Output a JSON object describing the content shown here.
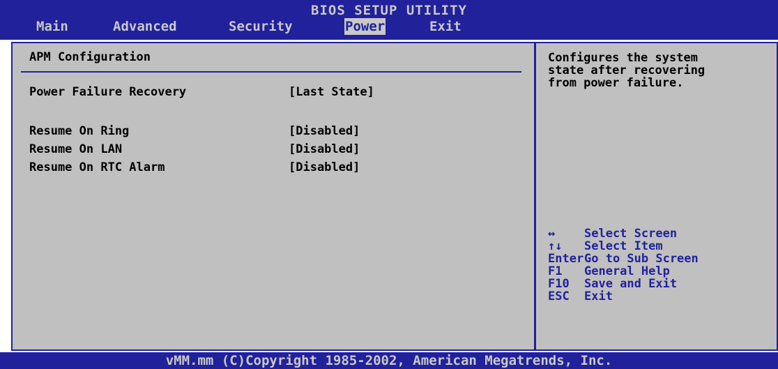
{
  "header": {
    "title": "BIOS SETUP UTILITY",
    "menu": [
      {
        "label": "Main"
      },
      {
        "label": "Advanced"
      },
      {
        "label": "Security"
      },
      {
        "label": "Power"
      },
      {
        "label": "Exit"
      }
    ]
  },
  "section": {
    "title": "APM Configuration",
    "settings": [
      {
        "label": "Power Failure Recovery",
        "value": "[Last State]"
      },
      {
        "label": "Resume On Ring",
        "value": "[Disabled]"
      },
      {
        "label": "Resume On LAN",
        "value": "[Disabled]"
      },
      {
        "label": "Resume On RTC Alarm",
        "value": "[Disabled]"
      }
    ]
  },
  "help": {
    "text": "Configures the system\nstate after recovering\nfrom power failure.",
    "keys": [
      {
        "key": "↔",
        "desc": "Select Screen"
      },
      {
        "key": "↑↓",
        "desc": "Select Item"
      },
      {
        "key": "Enter",
        "desc": "Go to Sub Screen"
      },
      {
        "key": "F1",
        "desc": "General Help"
      },
      {
        "key": "F10",
        "desc": "Save and Exit"
      },
      {
        "key": "ESC",
        "desc": "Exit"
      }
    ]
  },
  "footer": {
    "text": "vMM.mm (C)Copyright 1985-2002, American Megatrends, Inc."
  },
  "colors": {
    "bios_blue": "#21219c",
    "panel_gray": "#c0c0c0",
    "menu_text": "#c8c8c8"
  }
}
